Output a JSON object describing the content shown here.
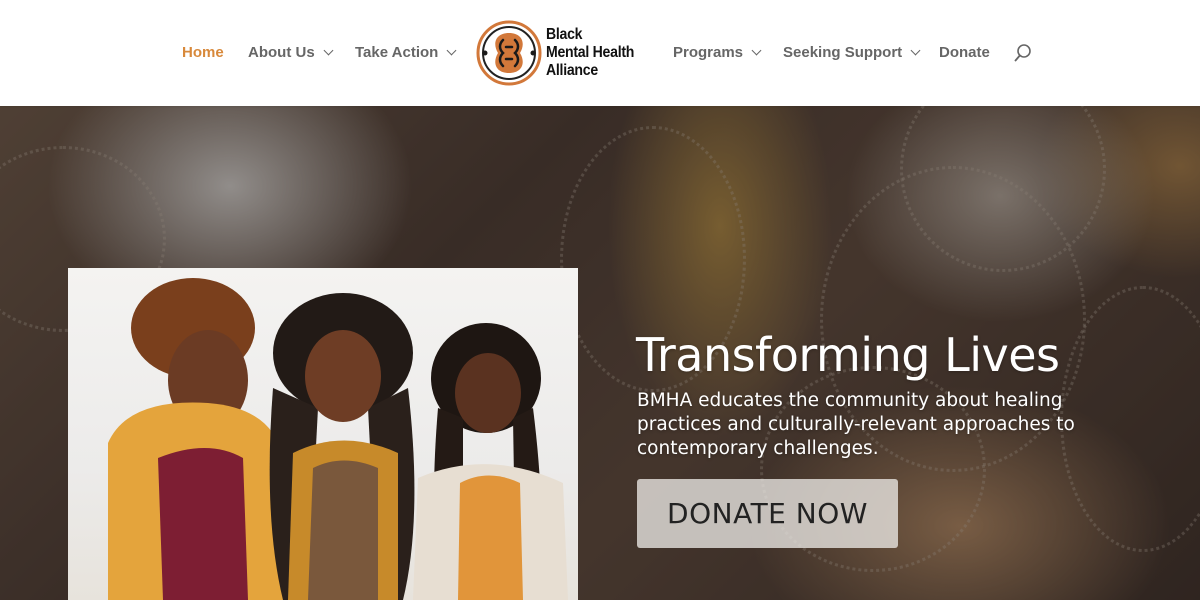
{
  "nav": {
    "items": [
      {
        "label": "Home",
        "active": true,
        "dropdown": false
      },
      {
        "label": "About Us",
        "active": false,
        "dropdown": true
      },
      {
        "label": "Take Action",
        "active": false,
        "dropdown": true
      },
      {
        "label": "Programs",
        "active": false,
        "dropdown": true
      },
      {
        "label": "Seeking Support",
        "active": false,
        "dropdown": true
      },
      {
        "label": "Donate",
        "active": false,
        "dropdown": false
      }
    ],
    "search_icon": "search-icon"
  },
  "logo": {
    "line1": "Black",
    "line2": "Mental Health",
    "line3": "Alliance"
  },
  "hero": {
    "title": "Transforming Lives",
    "text": "BMHA educates the community about healing practices and culturally-relevant approaches to contemporary challenges.",
    "button_label": "DONATE NOW"
  },
  "colors": {
    "accent": "#d8893b",
    "nav_text": "#666666",
    "button_bg": "rgba(235,232,228,0.78)"
  }
}
